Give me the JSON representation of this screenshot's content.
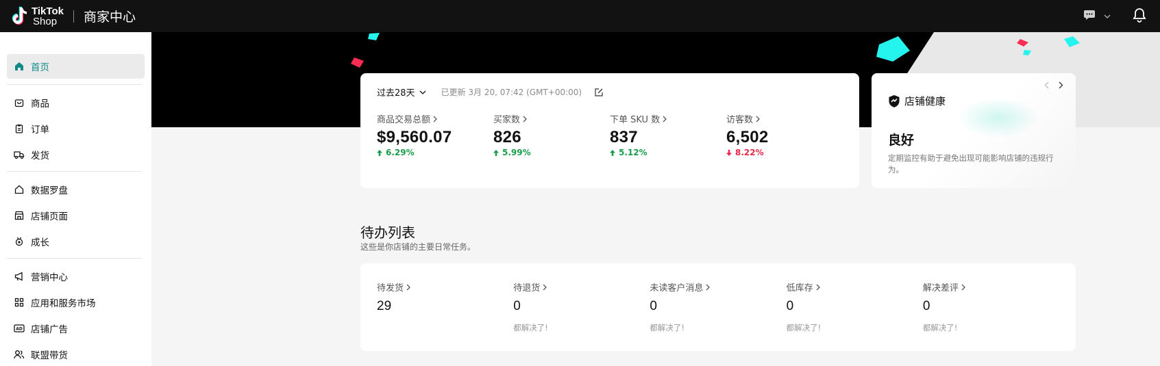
{
  "header": {
    "logo_title": "TikTok",
    "logo_subtitle": "Shop",
    "title": "商家中心"
  },
  "sidebar": {
    "items": [
      {
        "label": "首页",
        "icon": "home-icon",
        "active": true
      },
      {
        "label": "商品",
        "icon": "product-bag-icon"
      },
      {
        "label": "订单",
        "icon": "clipboard-icon"
      },
      {
        "label": "发货",
        "icon": "truck-icon"
      },
      {
        "label": "数据罗盘",
        "icon": "compass-home-icon"
      },
      {
        "label": "店铺页面",
        "icon": "storefront-icon"
      },
      {
        "label": "成长",
        "icon": "medal-icon"
      },
      {
        "label": "营销中心",
        "icon": "megaphone-icon"
      },
      {
        "label": "应用和服务市场",
        "icon": "apps-grid-icon"
      },
      {
        "label": "店铺广告",
        "icon": "ad-icon"
      },
      {
        "label": "联盟带货",
        "icon": "affiliate-users-icon"
      }
    ]
  },
  "stats": {
    "range": "过去28天",
    "updated": "已更新 3月 20, 07:42 (GMT+00:00)",
    "metrics": [
      {
        "label": "商品交易总额",
        "value": "$9,560.07",
        "change": "6.29%",
        "trend": "up"
      },
      {
        "label": "买家数",
        "value": "826",
        "change": "5.99%",
        "trend": "up"
      },
      {
        "label": "下单 SKU 数",
        "value": "837",
        "change": "5.12%",
        "trend": "up"
      },
      {
        "label": "访客数",
        "value": "6,502",
        "change": "8.22%",
        "trend": "down"
      }
    ]
  },
  "health": {
    "title": "店铺健康",
    "status": "良好",
    "description": "定期监控有助于避免出现可能影响店铺的违规行为。"
  },
  "todo": {
    "heading": "待办列表",
    "subheading": "这些是你店铺的主要日常任务。",
    "items": [
      {
        "label": "待发货",
        "value": "29",
        "note": ""
      },
      {
        "label": "待退货",
        "value": "0",
        "note": "都解决了!"
      },
      {
        "label": "未读客户消息",
        "value": "0",
        "note": "都解决了!"
      },
      {
        "label": "低库存",
        "value": "0",
        "note": "都解决了!"
      },
      {
        "label": "解决差评",
        "value": "0",
        "note": "都解决了!"
      }
    ]
  },
  "colors": {
    "accent": "#0f8a86",
    "up": "#1a9c4a",
    "down": "#e8294a",
    "confetti_cyan": "#25f4ee",
    "confetti_pink": "#fe2c55"
  }
}
